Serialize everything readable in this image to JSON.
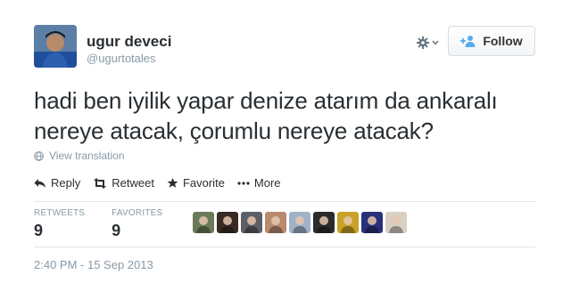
{
  "user": {
    "display_name": "ugur deveci",
    "screen_name": "@ugurtotales",
    "avatar_icon": "user-avatar"
  },
  "header": {
    "gear_icon": "gear-icon",
    "follow_label": "Follow",
    "follow_icon": "add-user-icon"
  },
  "tweet": {
    "lines": [
      "hadi ben iyilik yapar denize atarım da ankaralı",
      "nereye atacak, çorumlu nereye atacak?"
    ]
  },
  "translation": {
    "label": "View translation",
    "icon": "globe-icon"
  },
  "actions": {
    "reply": "Reply",
    "retweet": "Retweet",
    "favorite": "Favorite",
    "more": "More"
  },
  "stats": {
    "retweets_label": "RETWEETS",
    "retweets_value": "9",
    "favorites_label": "FAVORITES",
    "favorites_value": "9"
  },
  "favoriter_avatars": [
    {
      "name": "favoriter-1",
      "color": "#6b7b5a"
    },
    {
      "name": "favoriter-2",
      "color": "#3a2a24"
    },
    {
      "name": "favoriter-3",
      "color": "#5c5f63"
    },
    {
      "name": "favoriter-4",
      "color": "#b98b6e"
    },
    {
      "name": "favoriter-5",
      "color": "#9fb3c8"
    },
    {
      "name": "favoriter-6",
      "color": "#2b2b2b"
    },
    {
      "name": "favoriter-7",
      "color": "#c9a227"
    },
    {
      "name": "favoriter-8",
      "color": "#2a2f7a"
    },
    {
      "name": "favoriter-9",
      "color": "#d9cfc3"
    }
  ],
  "timestamp": "2:40 PM - 15 Sep 2013",
  "colors": {
    "text": "#292f33",
    "muted": "#8899a6",
    "follow_icon": "#55acee"
  }
}
